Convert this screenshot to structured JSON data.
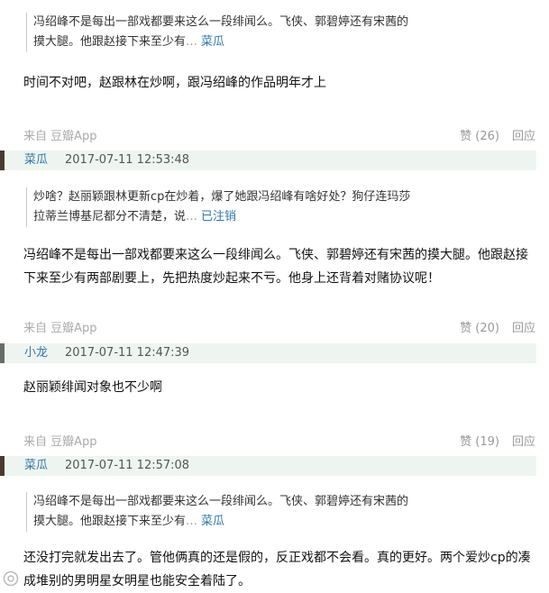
{
  "comments": [
    {
      "quote_text": "冯绍峰不是每出一部戏都要来这么一段绯闻么。飞侠、郭碧婷还有宋茜的摸大腿。他跟赵接下来至少有",
      "quote_ellipsis": "…",
      "quote_author": "菜瓜",
      "body": "时间不对吧，赵跟林在炒啊，跟冯绍峰的作品明年才上",
      "source": "来自 豆瓣App",
      "like_label": "赞 (26)",
      "reply_label": "回应"
    },
    {
      "author": "菜瓜",
      "time": "2017-07-11 12:53:48",
      "quote_text": "炒啥？赵丽颖跟林更新cp在炒着，爆了她跟冯绍峰有啥好处？狗仔连玛莎拉蒂兰博基尼都分不清楚，说",
      "quote_ellipsis": "…",
      "quote_author": "已注销",
      "body": "冯绍峰不是每出一部戏都要来这么一段绯闻么。飞侠、郭碧婷还有宋茜的摸大腿。他跟赵接下来至少有两部剧要上，先把热度炒起来不亏。他身上还背着对赌协议呢！",
      "source": "来自 豆瓣App",
      "like_label": "赞 (20)",
      "reply_label": "回应"
    },
    {
      "author": "小龙",
      "time": "2017-07-11 12:47:39",
      "body": "赵丽颖绯闻对象也不少啊",
      "source": "来自 豆瓣App",
      "like_label": "赞 (19)",
      "reply_label": "回应"
    },
    {
      "author": "菜瓜",
      "time": "2017-07-11 12:57:08",
      "quote_text": "冯绍峰不是每出一部戏都要来这么一段绯闻么。飞侠、郭碧婷还有宋茜的摸大腿。他跟赵接下来至少有",
      "quote_ellipsis": "…",
      "quote_author": "菜瓜",
      "body": "还没打完就发出去了。管他俩真的还是假的，反正戏都不会看。真的更好。两个爱炒cp的凑成堆别的男明星女明星也能安全着陆了。"
    }
  ]
}
